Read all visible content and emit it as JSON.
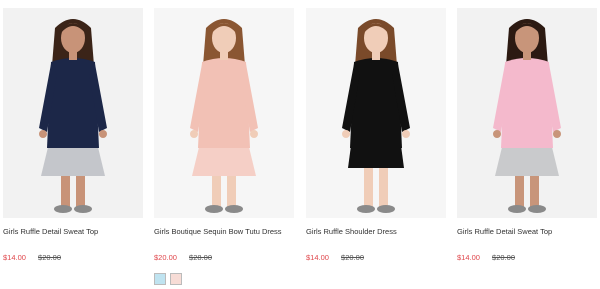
{
  "products": [
    {
      "name": "Girls Ruffle Detail Sweat Top",
      "price": "$14.00",
      "was_price": "$20.00",
      "colors": {
        "top": "#1c2748",
        "skirt": "#c4c6cb",
        "hair": "#3b2418",
        "skin": "#c89378",
        "bg": "#f2f2f2"
      }
    },
    {
      "name": "Girls Boutique Sequin Bow Tutu Dress",
      "price": "$20.00",
      "was_price": "$28.00",
      "colors": {
        "top": "#f2c1b5",
        "skirt": "#f5cfc6",
        "hair": "#8a5632",
        "skin": "#f0cdb8",
        "bg": "#f6f6f6"
      },
      "swatches": [
        {
          "name": "light-blue",
          "color": "#bfe3f0"
        },
        {
          "name": "pink",
          "color": "#f7dcd6"
        }
      ]
    },
    {
      "name": "Girls Ruffle Shoulder Dress",
      "price": "$14.00",
      "was_price": "$20.00",
      "colors": {
        "top": "#111111",
        "skirt": "#111111",
        "hair": "#7a4a2a",
        "skin": "#f0cdb8",
        "bg": "#f6f6f6"
      }
    },
    {
      "name": "Girls Ruffle Detail Sweat Top",
      "price": "$14.00",
      "was_price": "$20.00",
      "colors": {
        "top": "#f4b9cc",
        "skirt": "#c9cacc",
        "hair": "#2c1a12",
        "skin": "#c8957a",
        "bg": "#f2f2f2"
      }
    }
  ]
}
